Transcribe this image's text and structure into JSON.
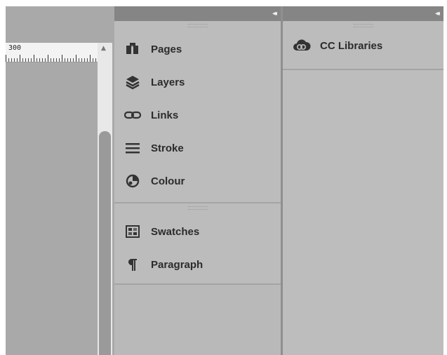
{
  "ruler": {
    "value": "300"
  },
  "panels_column1": {
    "group1": [
      {
        "label": "Pages",
        "icon": "pages-icon"
      },
      {
        "label": "Layers",
        "icon": "layers-icon"
      },
      {
        "label": "Links",
        "icon": "links-icon"
      },
      {
        "label": "Stroke",
        "icon": "stroke-icon"
      },
      {
        "label": "Colour",
        "icon": "colour-icon"
      }
    ],
    "group2": [
      {
        "label": "Swatches",
        "icon": "swatches-icon"
      },
      {
        "label": "Paragraph",
        "icon": "paragraph-icon"
      }
    ]
  },
  "panels_column2": {
    "libraries": {
      "label": "CC Libraries",
      "icon": "cc-libraries-icon"
    }
  },
  "colors": {
    "panel_bg": "#bcbcbc",
    "header_bg": "#858585",
    "text": "#2b2b2b"
  }
}
